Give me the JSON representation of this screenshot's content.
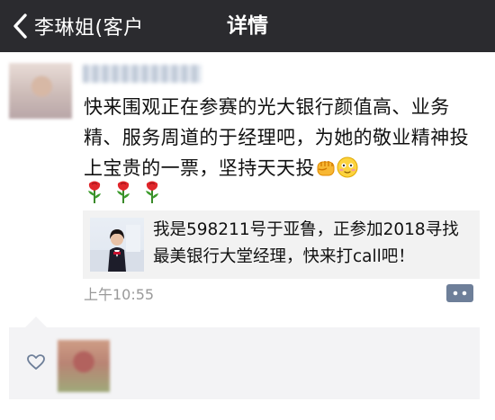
{
  "navbar": {
    "back_label": "李琳姐(客户",
    "title": "详情"
  },
  "post": {
    "text": "快来围观正在参赛的光大银行颜值高、业务精、服务周道的于经理吧，为她的敬业精神投上宝贵的一票，坚持天天投",
    "emojis": [
      "fist-emoji",
      "grin-emoji"
    ],
    "rose_count": 3,
    "time": "上午10:55"
  },
  "share": {
    "text": "我是598211号于亚鲁，正参加2018寻找最美银行大堂经理，快来打call吧！"
  },
  "colors": {
    "navbar_bg": "#2b2b2f",
    "link_blue": "#6e7f99",
    "time_gray": "#999999",
    "panel_bg": "#f3f3f5"
  }
}
